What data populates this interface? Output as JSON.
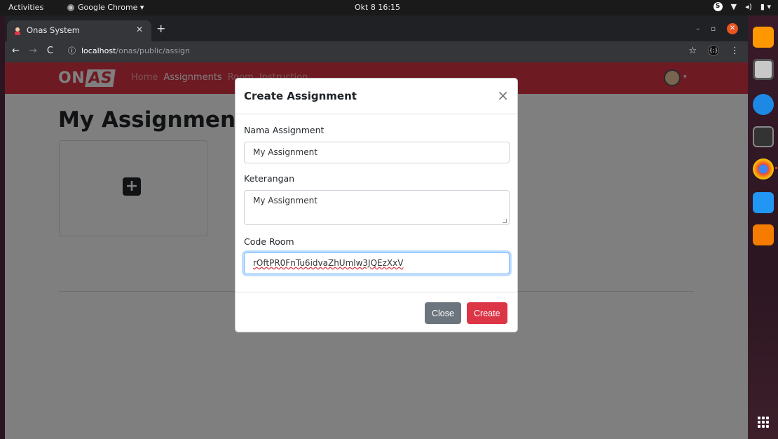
{
  "os": {
    "activities": "Activities",
    "app_menu": "Google Chrome ▾",
    "clock": "Okt 8 16:15"
  },
  "browser": {
    "tab_title": "Onas System",
    "url_host": "localhost",
    "url_path": "/onas/public/assign"
  },
  "navbar": {
    "brand_a": "ON",
    "brand_b": "AS",
    "links": [
      "Home",
      "Assignments",
      "Room",
      "Instruction"
    ]
  },
  "page": {
    "title": "My Assignments",
    "add_icon": "plus-square-icon"
  },
  "modal": {
    "title": "Create Assignment",
    "close_glyph": "×",
    "name_label": "Nama Assignment",
    "name_value": "My Assignment",
    "desc_label": "Keterangan",
    "desc_value": "My Assignment",
    "code_label": "Code Room",
    "code_value": "rOftPR0FnTu6idvaZhUmlw3JQEzXxV",
    "close_button": "Close",
    "create_button": "Create"
  },
  "colors": {
    "brand_red": "#dc3545",
    "secondary": "#6c757d",
    "ubuntu_orange": "#e95420"
  }
}
